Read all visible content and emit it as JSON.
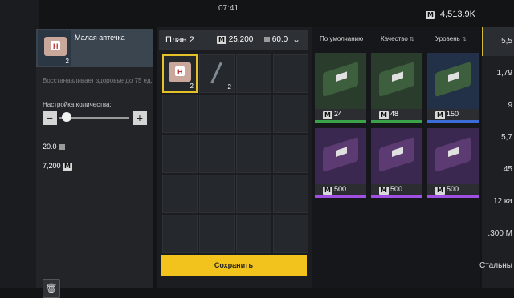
{
  "status_bar": {
    "time": "07:41"
  },
  "currency": {
    "icon": "M",
    "amount": "4,513.9K"
  },
  "item": {
    "name": "Малая аптечка",
    "count": "2",
    "description": "Восстанавливает здоровье до 75 ед.",
    "quantity_label": "Настройка количества:",
    "minus_label": "−",
    "plus_label": "+",
    "quantity_fraction": 0.05,
    "weight": "20.0",
    "price": "7,200",
    "price_icon": "M"
  },
  "plan": {
    "name": "План 2",
    "price": "25,200",
    "price_icon": "M",
    "weight": "60.0",
    "slots": [
      {
        "count": "2",
        "icon": "medkit-icon",
        "selected": true
      },
      {
        "count": "2",
        "icon": "syringe-icon",
        "selected": false
      }
    ],
    "save_label": "Сохранить"
  },
  "shop": {
    "sort_default": "По умолчанию",
    "sort_quality": "Качество",
    "sort_level": "Уровень",
    "cards": [
      {
        "price": "24",
        "rarity": "green"
      },
      {
        "price": "48",
        "rarity": "green"
      },
      {
        "price": "150",
        "rarity": "blue"
      },
      {
        "price": "500",
        "rarity": "purple"
      },
      {
        "price": "500",
        "rarity": "purple"
      },
      {
        "price": "500",
        "rarity": "purple"
      }
    ]
  },
  "right_column": {
    "values": [
      "5,5",
      "1,79",
      "9",
      "5,7",
      ".45",
      "12 ка",
      ".300 M",
      "Стальны"
    ]
  },
  "colors": {
    "accent_yellow": "#f3c31d",
    "selected_border": "#e3c128",
    "rarity_green": "#3aa34a",
    "rarity_blue": "#3b6bd6",
    "rarity_purple": "#a050e0"
  }
}
